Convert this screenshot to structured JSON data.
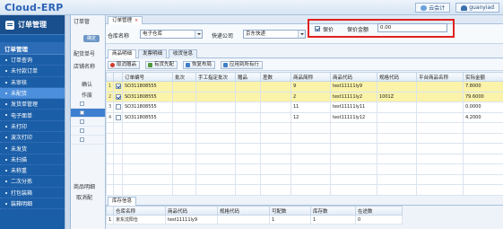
{
  "app": {
    "logo": "Cloud-ERP"
  },
  "topbar": {
    "cloud_label": "云会计",
    "user_label": "guanyiad"
  },
  "sidebar": {
    "header": "订单管理",
    "section": "订单管理",
    "items": [
      {
        "label": "订单查询"
      },
      {
        "label": "未付款订单"
      },
      {
        "label": "未审核"
      },
      {
        "label": "未配货"
      },
      {
        "label": "发货单管理"
      },
      {
        "label": "电子面单"
      },
      {
        "label": "未打印"
      },
      {
        "label": "波次打印"
      },
      {
        "label": "未发货"
      },
      {
        "label": "未扫描"
      },
      {
        "label": "未称重"
      },
      {
        "label": "二次分拣"
      },
      {
        "label": "打包装箱"
      },
      {
        "label": "装箱明细"
      }
    ],
    "active_index": 3
  },
  "col3": {
    "tab_label": "订单管",
    "btn_label": "确定",
    "label_a": "配货单号",
    "label_b": "店铺名称",
    "row_labels": [
      "确认",
      "作废"
    ],
    "bottom_label": "商品明细",
    "bottom_btn": "取消配"
  },
  "main": {
    "tab_top": "订单管理",
    "form": {
      "warehouse_label": "仓库名称",
      "warehouse_value": "电子仓库",
      "express_label": "快递公司",
      "express_value": "京东快递",
      "insured_label": "保价",
      "insured_checked": true,
      "insured_amount_label": "保价金额",
      "insured_amount_value": "0.00"
    },
    "tabs": [
      "商品明细",
      "发票明细",
      "收货信息"
    ],
    "active_tab": 0,
    "toolbar": [
      "取消赠品",
      "有货先配",
      "恢复布局",
      "应用到所有行"
    ],
    "columns": [
      "",
      "",
      "订单编号",
      "批次",
      "手工指定批次",
      "赠品",
      "差数",
      "商品简称",
      "商品代码",
      "规格代码",
      "平台商品名称",
      "实际金额"
    ],
    "rows": [
      {
        "n": "1",
        "checked": true,
        "order": "SO311808555",
        "batch": "",
        "manual": "",
        "gift": "",
        "diff": "",
        "short": "9",
        "code": "test11111ly9",
        "spec": "",
        "pname": "",
        "amount": "7.8000",
        "hl": true
      },
      {
        "n": "2",
        "checked": true,
        "order": "SO311808555",
        "batch": "",
        "manual": "",
        "gift": "",
        "diff": "",
        "short": "2",
        "code": "test11111ly2",
        "spec": "1001Z",
        "pname": "",
        "amount": "79.6000",
        "hl": true
      },
      {
        "n": "3",
        "checked": false,
        "order": "SO311808555",
        "batch": "",
        "manual": "",
        "gift": "",
        "diff": "",
        "short": "11",
        "code": "test11111ly11",
        "spec": "",
        "pname": "",
        "amount": "0.0000",
        "hl": false
      },
      {
        "n": "4",
        "checked": false,
        "order": "SO311808555",
        "batch": "",
        "manual": "",
        "gift": "",
        "diff": "",
        "short": "12",
        "code": "test11111ly12",
        "spec": "",
        "pname": "",
        "amount": "4.2000",
        "hl": false
      }
    ],
    "stock": {
      "title": "库存信息",
      "columns": [
        "",
        "仓库名称",
        "商品代码",
        "规格代码",
        "可配数",
        "库存数",
        "在途数"
      ],
      "rows": [
        {
          "n": "1",
          "wh": "京东沈阳仓",
          "code": "test11111ly9",
          "spec": "",
          "avail": "1",
          "qty": "1",
          "transit": "0"
        }
      ]
    }
  }
}
